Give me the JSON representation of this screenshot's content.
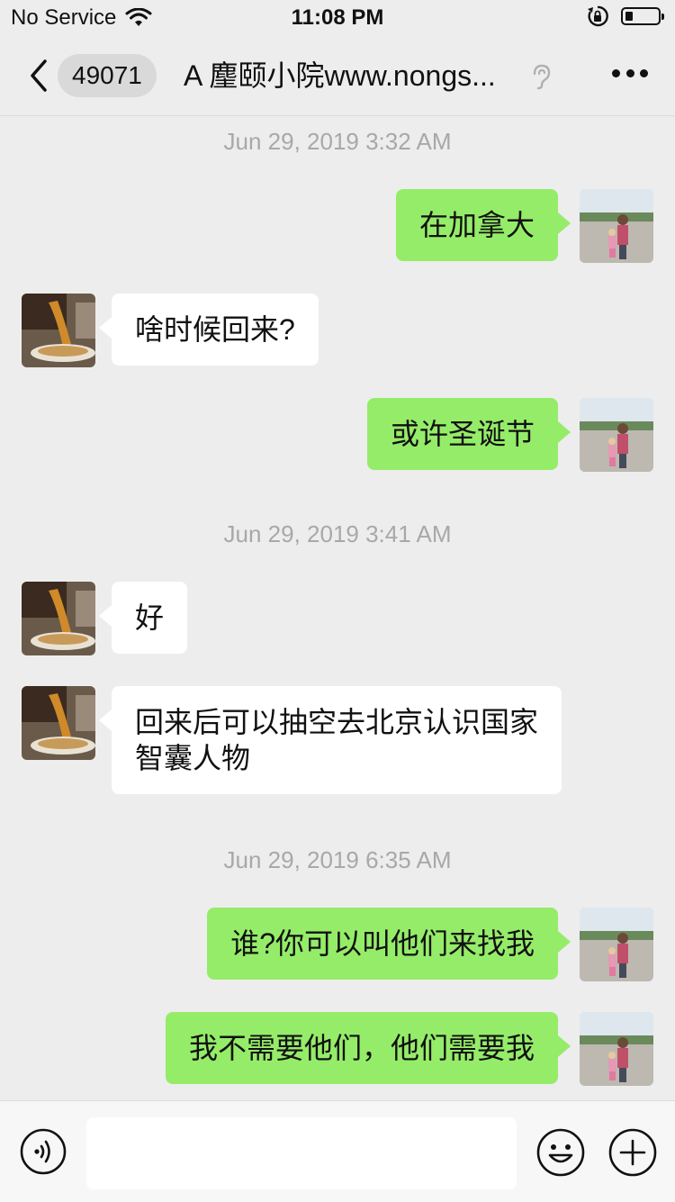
{
  "status_bar": {
    "carrier": "No Service",
    "time": "11:08 PM"
  },
  "nav": {
    "unread_count": "49071",
    "title": "A 麈颐小院www.nongs..."
  },
  "timestamps": [
    "Jun 29, 2019 3:32 AM",
    "Jun 29, 2019 3:41 AM",
    "Jun 29, 2019 6:35 AM"
  ],
  "messages": [
    {
      "from": "me",
      "text": "在加拿大"
    },
    {
      "from": "contact",
      "text": "啥时候回来?"
    },
    {
      "from": "me",
      "text": "或许圣诞节"
    },
    {
      "from": "contact",
      "text": "好"
    },
    {
      "from": "contact",
      "text": "回来后可以抽空去北京认识国家智囊人物"
    },
    {
      "from": "me",
      "text": "谁?你可以叫他们来找我"
    },
    {
      "from": "me",
      "text": "我不需要他们，他们需要我"
    }
  ],
  "input": {
    "value": "",
    "placeholder": ""
  },
  "icons": {
    "back": "chevron-left-icon",
    "ear": "ear-icon",
    "more": "more-icon",
    "voice": "voice-icon",
    "emoji": "emoji-icon",
    "plus": "plus-icon",
    "wifi": "wifi-icon",
    "rotation_lock": "rotation-lock-icon",
    "battery": "battery-icon"
  },
  "colors": {
    "outgoing_bubble": "#95ec69",
    "incoming_bubble": "#ffffff",
    "background": "#ededed"
  }
}
